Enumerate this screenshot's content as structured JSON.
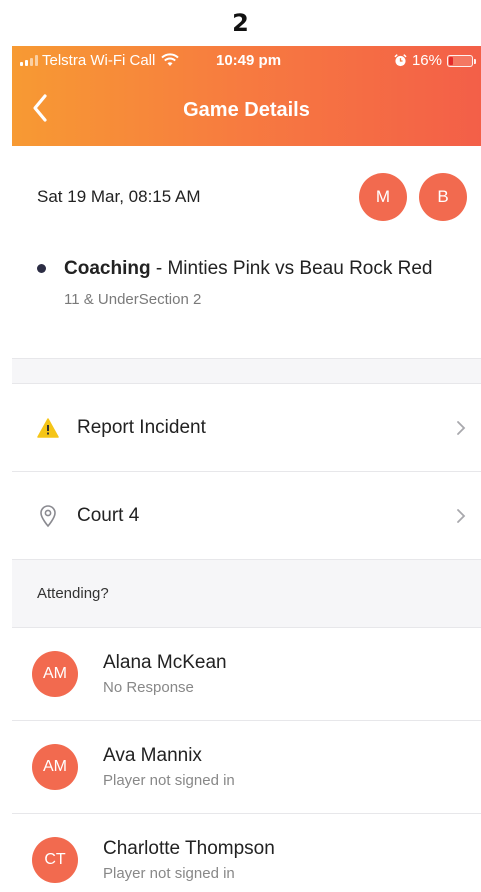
{
  "page_label": "2",
  "status_bar": {
    "carrier": "Telstra Wi-Fi Call",
    "time": "10:49 pm",
    "battery_text": "16%",
    "battery_level": 0.16
  },
  "nav": {
    "title": "Game Details",
    "back_icon": "chevron-left-icon"
  },
  "game": {
    "datetime": "Sat 19 Mar, 08:15 AM",
    "avatars": [
      "M",
      "B"
    ],
    "type": "Coaching",
    "matchup": " - Minties Pink vs Beau Rock Red",
    "section": "11 & UnderSection 2"
  },
  "rows": {
    "report_incident": "Report Incident",
    "court": "Court 4"
  },
  "attending": {
    "header": "Attending?",
    "people": [
      {
        "initials": "AM",
        "name": "Alana McKean",
        "status": "No Response"
      },
      {
        "initials": "AM",
        "name": "Ava Mannix",
        "status": "Player not signed in"
      },
      {
        "initials": "CT",
        "name": "Charlotte Thompson",
        "status": "Player not signed in"
      }
    ]
  },
  "colors": {
    "accent": "#f26a4f",
    "header_gradient_start": "#f79a33",
    "header_gradient_end": "#f35f48",
    "warning": "#f5c518"
  }
}
